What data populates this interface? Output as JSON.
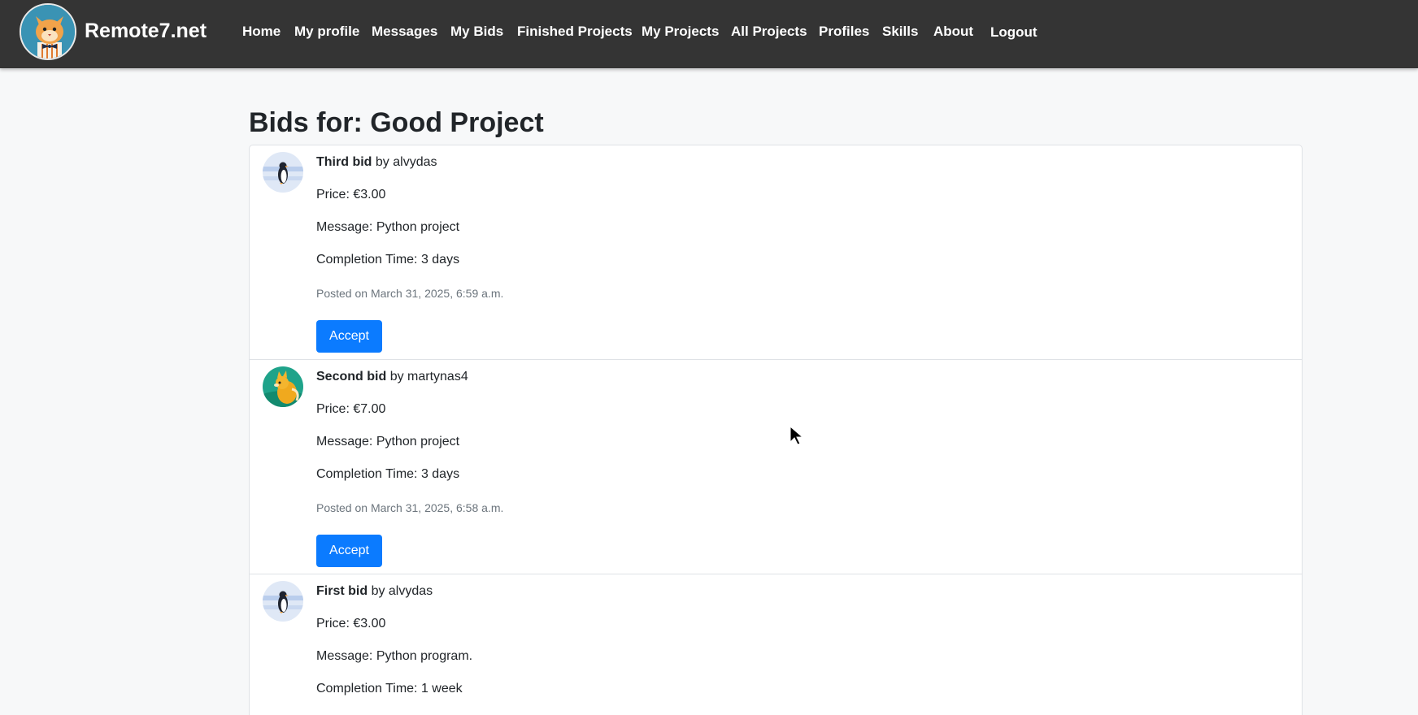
{
  "brand": {
    "name": "Remote7.net",
    "logo_icon": "cat-logo-icon"
  },
  "nav": {
    "items": [
      {
        "label": "Home"
      },
      {
        "label": "My profile"
      },
      {
        "label": "Messages"
      },
      {
        "label": "My Bids"
      },
      {
        "label": "Finished Projects"
      },
      {
        "label": "My Projects"
      },
      {
        "label": "All Projects"
      },
      {
        "label": "Profiles"
      },
      {
        "label": "Skills"
      },
      {
        "label": "About"
      },
      {
        "label": "Logout"
      }
    ]
  },
  "page": {
    "title_label": "Bids for:",
    "project_name": "Good Project"
  },
  "bids": [
    {
      "title": "Third bid",
      "by_text": "by alvydas",
      "price": "Price: €3.00",
      "message": "Message: Python project",
      "completion": "Completion Time: 3 days",
      "posted": "Posted on March 31, 2025, 6:59 a.m.",
      "accept_label": "Accept",
      "avatar_icon": "penguin-avatar-icon"
    },
    {
      "title": "Second bid",
      "by_text": "by martynas4",
      "price": "Price: €7.00",
      "message": "Message: Python project",
      "completion": "Completion Time: 3 days",
      "posted": "Posted on March 31, 2025, 6:58 a.m.",
      "accept_label": "Accept",
      "avatar_icon": "fox-avatar-icon"
    },
    {
      "title": "First bid",
      "by_text": "by alvydas",
      "price": "Price: €3.00",
      "message": "Message: Python program.",
      "completion": "Completion Time: 1 week",
      "avatar_icon": "penguin-avatar-icon"
    }
  ],
  "colors": {
    "navbar_bg": "#343434",
    "page_bg": "#f7f8f9",
    "accent_button": "#0b7bff",
    "muted_text": "#6c757d"
  }
}
